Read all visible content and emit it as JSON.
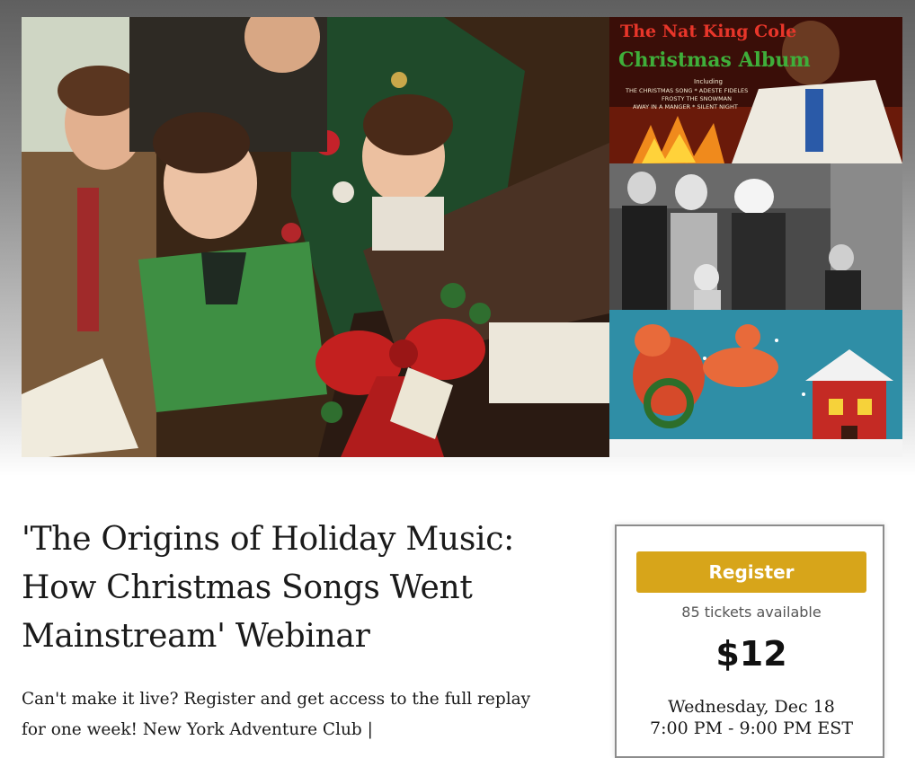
{
  "hero": {
    "album_title_line1": "The Nat King Cole",
    "album_title_line2": "Christmas Album",
    "album_including": "Including",
    "album_tracks_line1": "THE CHRISTMAS SONG * ADESTE FIDELES",
    "album_tracks_line2": "FROSTY THE SNOWMAN",
    "album_tracks_line3": "AWAY IN A MANGER * SILENT NIGHT"
  },
  "event": {
    "title": "'The Origins of Holiday Music: How Christmas Songs Went Mainstream' Webinar",
    "description": "Can't make it live? Register and get access to the full replay for one week! New York Adventure Club |"
  },
  "ticket": {
    "register_label": "Register",
    "availability": "85 tickets available",
    "price": "$12",
    "date": "Wednesday, Dec 18",
    "time": "7:00 PM - 9:00 PM EST"
  },
  "colors": {
    "register_button": "#d7a51a",
    "album_title_red": "#e8362a",
    "album_title_green": "#3fae3a"
  }
}
